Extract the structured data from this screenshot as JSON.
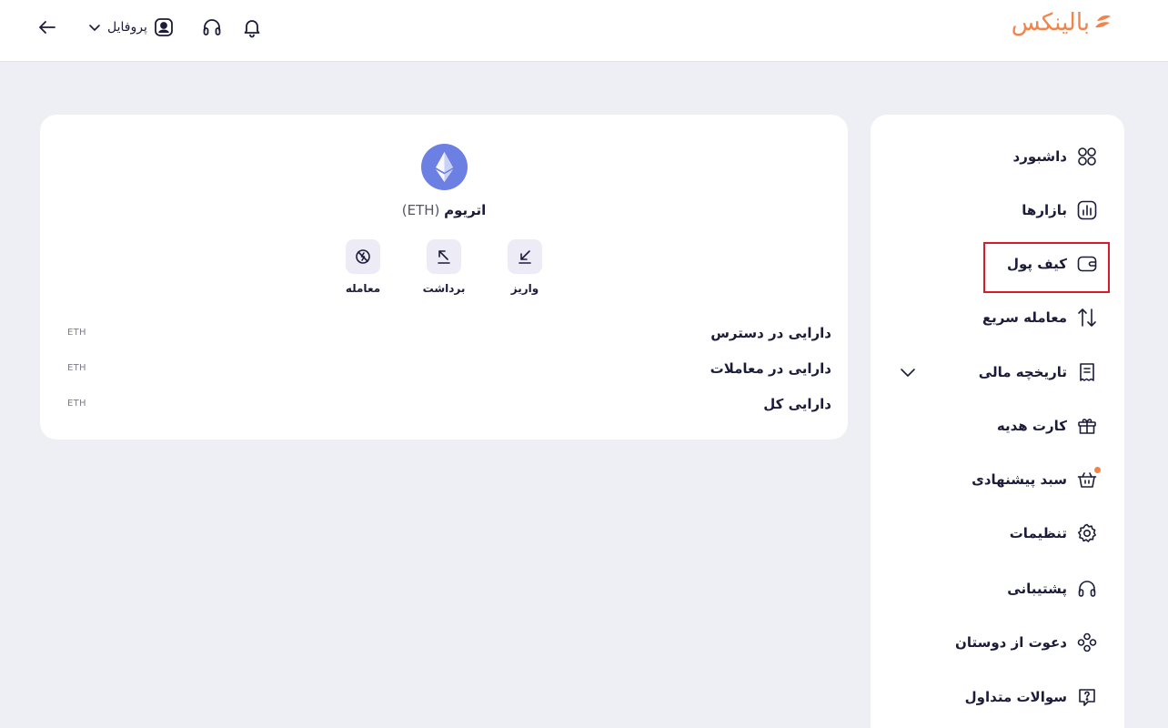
{
  "header": {
    "logo_text": "بالینکس",
    "profile_label": "پروفایل",
    "icons": [
      "arrow-left-icon",
      "chevron-down-icon",
      "user-icon",
      "headset-icon",
      "bell-icon"
    ]
  },
  "coin": {
    "name": "اتریوم",
    "symbol": "(ETH)",
    "actions": [
      {
        "label": "واریز",
        "icon": "arrow-down-left-icon"
      },
      {
        "label": "برداشت",
        "icon": "arrow-up-left-icon"
      },
      {
        "label": "معامله",
        "icon": "no-trade-icon"
      }
    ],
    "balances": [
      {
        "label": "دارایی در دسترس",
        "unit": "ETH"
      },
      {
        "label": "دارایی در معاملات",
        "unit": "ETH"
      },
      {
        "label": "دارایی کل",
        "unit": "ETH"
      }
    ]
  },
  "sidebar": {
    "items": [
      {
        "label": "داشبورد",
        "icon": "grid-icon"
      },
      {
        "label": "بازارها",
        "icon": "market-chart-icon"
      },
      {
        "label": "کیف پول",
        "icon": "wallet-icon",
        "highlighted": true
      },
      {
        "label": "معامله سریع",
        "icon": "swap-arrows-icon"
      },
      {
        "label": "تاریخچه مالی",
        "icon": "receipt-icon"
      },
      {
        "label": "کارت هدیه",
        "icon": "gift-icon"
      },
      {
        "label": "سبد پیشنهادی",
        "icon": "basket-icon"
      },
      {
        "label": "تنظیمات",
        "icon": "gear-icon"
      },
      {
        "label": "پشتیبانی",
        "icon": "headset-icon"
      },
      {
        "label": "دعوت از دوستان",
        "icon": "users-icon"
      },
      {
        "label": "سوالات متداول",
        "icon": "help-icon"
      }
    ]
  },
  "colors": {
    "brand": "#f0844a",
    "ethereum": "#6c7fe2",
    "highlight_border": "#d81a2a",
    "background": "#eeeef5"
  }
}
